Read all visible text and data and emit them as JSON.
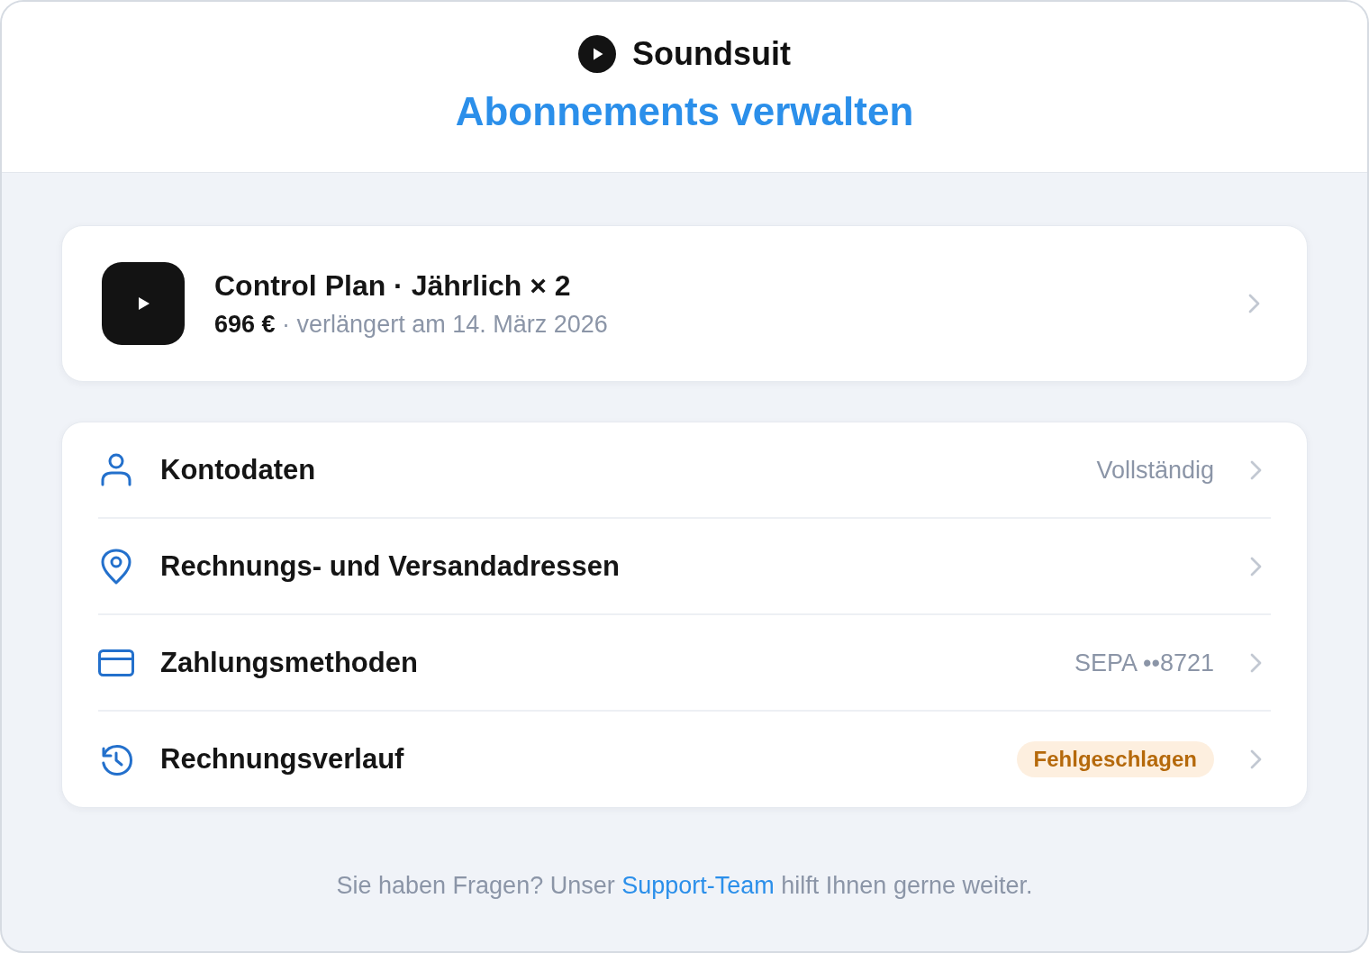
{
  "brand": {
    "name": "Soundsuit"
  },
  "title": "Abonnements verwalten",
  "subscription": {
    "title": "Control Plan · Jährlich × 2",
    "details": "**696 €** · verlängert am 14. März 2026"
  },
  "menu": [
    {
      "kind": "value",
      "label": "Kontodaten",
      "value": "Vollständig"
    },
    {
      "kind": "plain",
      "label": "Rechnungs- und Versandadressen"
    },
    {
      "kind": "value",
      "label": "Zahlungsmethoden",
      "value": "SEPA ••8721"
    },
    {
      "kind": "badge",
      "label": "Rechnungsverlauf",
      "value": "Fehlgeschlagen"
    }
  ],
  "footer": {
    "before": "Sie haben Fragen? Unser ",
    "link": "Support-Team",
    "after": " hilft Ihnen gerne weiter."
  }
}
